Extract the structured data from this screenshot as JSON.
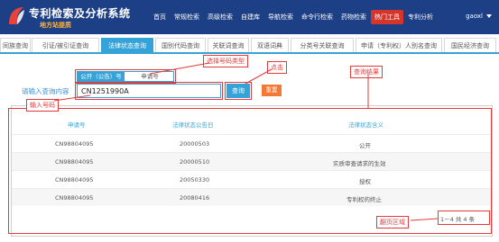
{
  "header": {
    "title": "专利检索及分析系统",
    "subtitle": "地方站提质",
    "nav": [
      "首页",
      "常规检索",
      "高级检索",
      "自建库",
      "导航检索",
      "命令行检索",
      "药物检索",
      "热门工具",
      "专利分析"
    ],
    "active_nav": "热门工具",
    "user": "gaoxl"
  },
  "tabs": [
    "同族查询",
    "引证/被引证查询",
    "法律状态查询",
    "国别代码查询",
    "关联词查询",
    "双语词典",
    "分类号关联查询",
    "申请（专利权）人别名查询",
    "国民经济查询"
  ],
  "active_tab": "法律状态查询",
  "search": {
    "type_tabs": [
      "公开（公告）号",
      "申请号"
    ],
    "active_type": "公开（公告）号",
    "query_value": "CN1251990A",
    "query_button": "查询",
    "reset_button": "重置"
  },
  "results": {
    "columns": [
      "申请号",
      "法律状态公告日",
      "法律状态含义"
    ],
    "rows": [
      [
        "CN98804095",
        "20000503",
        "公开"
      ],
      [
        "CN98804095",
        "20000510",
        "实质审查请求的生效"
      ],
      [
        "CN98804095",
        "20050330",
        "授权"
      ],
      [
        "CN98804095",
        "20080416",
        "专利权的终止"
      ]
    ],
    "pager": "1－4 共 4 条"
  },
  "annotations": {
    "select_type": "选择号码类型",
    "click": "点击",
    "results": "查询结果",
    "enter_hint": "请输入查询内容",
    "enter_number": "输入号码",
    "pager_area": "翻页区域"
  },
  "colors": {
    "header_bg": "#1c3f86",
    "accent": "#35a3d8",
    "active_nav": "#d4362c",
    "reset": "#f37735",
    "annotation": "#e23b3b"
  }
}
